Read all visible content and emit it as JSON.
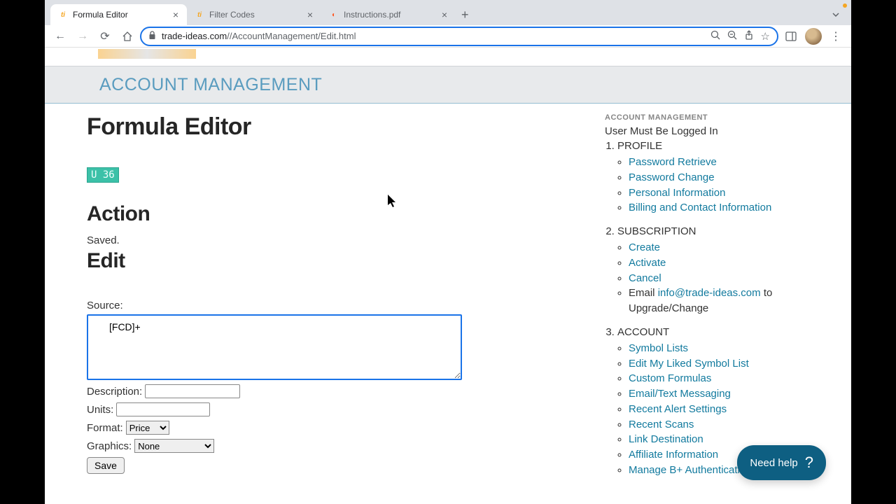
{
  "tabs": {
    "tab0": {
      "title": "Formula Editor"
    },
    "tab1": {
      "title": "Filter Codes"
    },
    "tab2": {
      "title": "Instructions.pdf"
    }
  },
  "url": {
    "domain": "trade-ideas.com",
    "path": "//AccountManagement/Edit.html"
  },
  "page": {
    "acct_bar": "ACCOUNT MANAGEMENT",
    "title": "Formula Editor",
    "badge": "U 36",
    "action_heading": "Action",
    "saved": "Saved.",
    "edit_heading": "Edit",
    "form": {
      "source_label": "Source:",
      "source_value": "[FCD]+",
      "description_label": "Description:",
      "description_value": "",
      "units_label": "Units:",
      "units_value": "",
      "format_label": "Format:",
      "format_value": "Price",
      "graphics_label": "Graphics:",
      "graphics_value": "None",
      "save_button": "Save"
    }
  },
  "sidebar": {
    "heading": "ACCOUNT MANAGEMENT",
    "note": "User Must Be Logged In",
    "sections": {
      "profile": {
        "label": "PROFILE",
        "items": {
          "i0": "Password Retrieve",
          "i1": "Password Change",
          "i2": "Personal Information",
          "i3": "Billing and Contact Information"
        }
      },
      "subscription": {
        "label": "SUBSCRIPTION",
        "items": {
          "i0": "Create",
          "i1": "Activate",
          "i2": "Cancel",
          "i3_prefix": "Email ",
          "i3_link": "info@trade-ideas.com",
          "i3_suffix": " to Upgrade/Change"
        }
      },
      "account": {
        "label": "ACCOUNT",
        "items": {
          "i0": "Symbol Lists",
          "i1": "Edit My Liked Symbol List",
          "i2": "Custom Formulas",
          "i3": "Email/Text Messaging",
          "i4": "Recent Alert Settings",
          "i5": "Recent Scans",
          "i6": "Link Destination",
          "i7": "Affiliate Information",
          "i8": "Manage B+ Authentication Tokens"
        }
      }
    }
  },
  "help": {
    "label": "Need help"
  }
}
